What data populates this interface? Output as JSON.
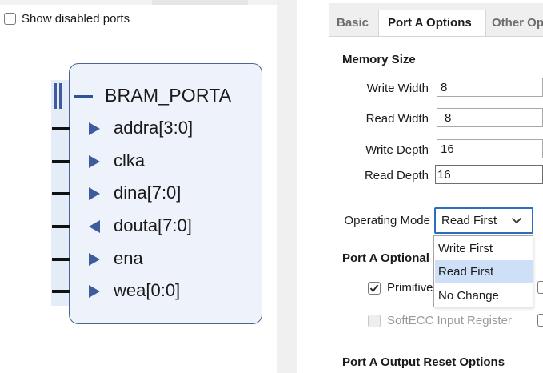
{
  "left_panel": {
    "show_disabled_ports_label": "Show disabled ports",
    "show_disabled_ports_checked": false,
    "block": {
      "title": "BRAM_PORTA",
      "ports": [
        {
          "name": "addra[3:0]",
          "direction": "input"
        },
        {
          "name": "clka",
          "direction": "input"
        },
        {
          "name": "dina[7:0]",
          "direction": "input"
        },
        {
          "name": "douta[7:0]",
          "direction": "output"
        },
        {
          "name": "ena",
          "direction": "input"
        },
        {
          "name": "wea[0:0]",
          "direction": "input"
        }
      ]
    }
  },
  "right_panel": {
    "tabs": [
      {
        "label": "Basic",
        "active": false
      },
      {
        "label": "Port A Options",
        "active": true
      },
      {
        "label": "Other Op",
        "active": false
      }
    ],
    "memory_size": {
      "title": "Memory Size",
      "write_width": {
        "label": "Write Width",
        "value": "8"
      },
      "read_width": {
        "label": "Read Width",
        "value": "8"
      },
      "write_depth": {
        "label": "Write Depth",
        "value": "16"
      },
      "read_depth": {
        "label": "Read Depth",
        "value": "16"
      }
    },
    "operating_mode": {
      "label": "Operating Mode",
      "selected": "Read First",
      "options": [
        "Write First",
        "Read First",
        "No Change"
      ],
      "highlighted_index": 1
    },
    "optional": {
      "title": "Port A Optional",
      "primitive_label": "Primitive",
      "primitive_checked": true,
      "softecc_label": "SoftECC Input Register",
      "softecc_enabled": false
    },
    "output_reset": {
      "title": "Port A Output Reset Options"
    }
  },
  "colors": {
    "accent": "#2b6cc4",
    "block_fill": "#eef2fa",
    "block_border": "#4a6591",
    "port_arrow": "#3e5b9e",
    "selection": "#cde0f7"
  },
  "icons": [
    "checkbox-icon",
    "minus-icon",
    "input-arrow-icon",
    "output-arrow-icon",
    "chevron-down-icon",
    "checkmark-icon"
  ]
}
